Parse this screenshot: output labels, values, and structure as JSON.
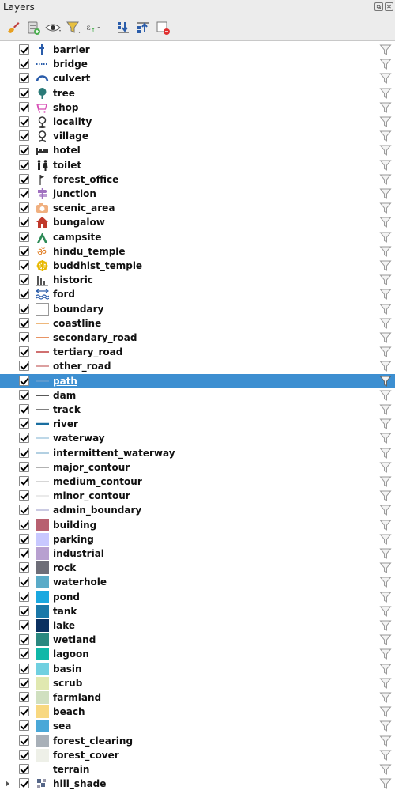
{
  "panel": {
    "title": "Layers"
  },
  "toolbar": {
    "buttons": [
      {
        "name": "style-manager-button",
        "icon": "paintbrush-icon"
      },
      {
        "name": "add-group-button",
        "icon": "add-group-icon"
      },
      {
        "name": "manage-visibility-button",
        "icon": "eye-icon"
      },
      {
        "name": "filter-legend-button",
        "icon": "filter-icon"
      },
      {
        "name": "filter-expression-button",
        "icon": "expression-filter-icon"
      },
      {
        "name": "expand-all-button",
        "icon": "expand-all-icon"
      },
      {
        "name": "collapse-all-button",
        "icon": "collapse-all-icon"
      },
      {
        "name": "remove-layer-button",
        "icon": "remove-layer-icon"
      }
    ]
  },
  "layers": [
    {
      "label": "barrier",
      "symbol": "barrier",
      "color": "#2a5caa",
      "checked": true
    },
    {
      "label": "bridge",
      "symbol": "dots",
      "color": "#2a5caa",
      "checked": true
    },
    {
      "label": "culvert",
      "symbol": "arch",
      "color": "#2a5caa",
      "checked": true
    },
    {
      "label": "tree",
      "symbol": "tree",
      "color": "#2b7a78",
      "checked": true
    },
    {
      "label": "shop",
      "symbol": "cart",
      "color": "#d64ab4",
      "checked": true
    },
    {
      "label": "locality",
      "symbol": "pin",
      "color": "#333333",
      "checked": true
    },
    {
      "label": "village",
      "symbol": "pin",
      "color": "#333333",
      "checked": true
    },
    {
      "label": "hotel",
      "symbol": "bed",
      "color": "#333333",
      "checked": true
    },
    {
      "label": "toilet",
      "symbol": "toilet",
      "color": "#222222",
      "checked": true
    },
    {
      "label": "forest_office",
      "symbol": "flag",
      "color": "#333333",
      "checked": true
    },
    {
      "label": "junction",
      "symbol": "signpost",
      "color": "#a070c0",
      "checked": true
    },
    {
      "label": "scenic_area",
      "symbol": "camera",
      "color": "#f0b080",
      "checked": true
    },
    {
      "label": "bungalow",
      "symbol": "house",
      "color": "#c0392b",
      "checked": true
    },
    {
      "label": "campsite",
      "symbol": "tent",
      "color": "#2e8b57",
      "checked": true
    },
    {
      "label": "hindu_temple",
      "symbol": "om",
      "color": "#e07b20",
      "checked": true
    },
    {
      "label": "buddhist_temple",
      "symbol": "wheel",
      "color": "#e8b800",
      "checked": true
    },
    {
      "label": "historic",
      "symbol": "ruin",
      "color": "#555555",
      "checked": true
    },
    {
      "label": "ford",
      "symbol": "ford",
      "color": "#2a5caa",
      "checked": true
    },
    {
      "label": "boundary",
      "symbol": "box",
      "color": "#ffffff",
      "checked": true
    },
    {
      "label": "coastline",
      "symbol": "line",
      "color": "#e8a050",
      "checked": true
    },
    {
      "label": "secondary_road",
      "symbol": "line",
      "color": "#e07030",
      "checked": true
    },
    {
      "label": "tertiary_road",
      "symbol": "line",
      "color": "#c04040",
      "checked": true
    },
    {
      "label": "other_road",
      "symbol": "line",
      "color": "#d08080",
      "checked": true
    },
    {
      "label": "path",
      "symbol": "line",
      "color": "#6a9fd0",
      "checked": true,
      "selected": true
    },
    {
      "label": "dam",
      "symbol": "line",
      "color": "#222222",
      "checked": true
    },
    {
      "label": "track",
      "symbol": "line",
      "color": "#555555",
      "checked": true
    },
    {
      "label": "river",
      "symbol": "thickline",
      "color": "#1a6ea0",
      "checked": true
    },
    {
      "label": "waterway",
      "symbol": "line",
      "color": "#a8cce0",
      "checked": true
    },
    {
      "label": "intermittent_waterway",
      "symbol": "line",
      "color": "#9ac0d8",
      "checked": true
    },
    {
      "label": "major_contour",
      "symbol": "line",
      "color": "#999999",
      "checked": true
    },
    {
      "label": "medium_contour",
      "symbol": "line",
      "color": "#c8c8c8",
      "checked": true
    },
    {
      "label": "minor_contour",
      "symbol": "line",
      "color": "#e4e4e4",
      "checked": true
    },
    {
      "label": "admin_boundary",
      "symbol": "line",
      "color": "#b8b8d8",
      "checked": true
    },
    {
      "label": "building",
      "symbol": "fill",
      "color": "#b86070",
      "checked": true
    },
    {
      "label": "parking",
      "symbol": "fill",
      "color": "#c8c8ff",
      "checked": true
    },
    {
      "label": "industrial",
      "symbol": "fill",
      "color": "#b8a0d0",
      "checked": true
    },
    {
      "label": "rock",
      "symbol": "fill",
      "color": "#6e6e78",
      "checked": true
    },
    {
      "label": "waterhole",
      "symbol": "fill",
      "color": "#5aabc8",
      "checked": true
    },
    {
      "label": "pond",
      "symbol": "fill",
      "color": "#1aa8e0",
      "checked": true
    },
    {
      "label": "tank",
      "symbol": "fill",
      "color": "#1a78a8",
      "checked": true
    },
    {
      "label": "lake",
      "symbol": "fill",
      "color": "#0a3060",
      "checked": true
    },
    {
      "label": "wetland",
      "symbol": "fill",
      "color": "#2a8880",
      "checked": true
    },
    {
      "label": "lagoon",
      "symbol": "fill",
      "color": "#10b8a8",
      "checked": true
    },
    {
      "label": "basin",
      "symbol": "fill",
      "color": "#70d0e0",
      "checked": true
    },
    {
      "label": "scrub",
      "symbol": "fill",
      "color": "#e0e8b0",
      "checked": true
    },
    {
      "label": "farmland",
      "symbol": "fill",
      "color": "#d0e0c0",
      "checked": true
    },
    {
      "label": "beach",
      "symbol": "fill",
      "color": "#f8d880",
      "checked": true
    },
    {
      "label": "sea",
      "symbol": "fill",
      "color": "#4aa8d8",
      "checked": true
    },
    {
      "label": "forest_clearing",
      "symbol": "fill",
      "color": "#a8b0b8",
      "checked": true
    },
    {
      "label": "forest_cover",
      "symbol": "fill",
      "color": "#eef0e8",
      "checked": true
    },
    {
      "label": "terrain",
      "symbol": "none",
      "color": "#ffffff",
      "checked": true
    },
    {
      "label": "hill_shade",
      "symbol": "raster",
      "color": "#556688",
      "checked": true,
      "expandable": true
    }
  ]
}
